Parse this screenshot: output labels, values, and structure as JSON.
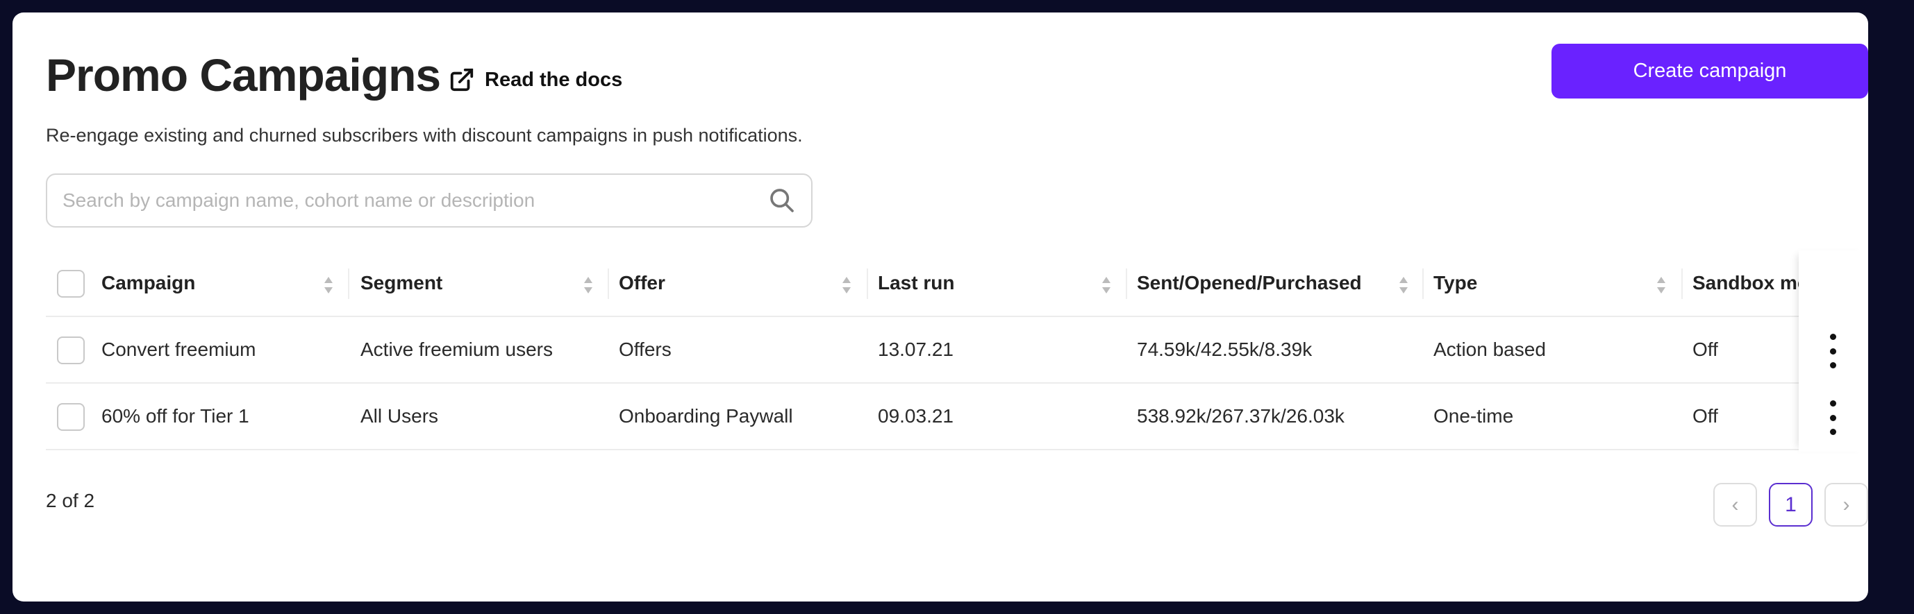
{
  "header": {
    "title": "Promo Campaigns",
    "docs_link": "Read the docs",
    "subtitle": "Re-engage existing and churned subscribers with discount campaigns in push notifications.",
    "create_button": "Create campaign"
  },
  "search": {
    "placeholder": "Search by campaign name, cohort name or description",
    "value": ""
  },
  "table": {
    "columns": [
      "Campaign",
      "Segment",
      "Offer",
      "Last run",
      "Sent/Opened/Purchased",
      "Type",
      "Sandbox mode"
    ],
    "rows": [
      [
        "Convert freemium",
        "Active freemium users",
        "Offers",
        "13.07.21",
        "74.59k/42.55k/8.39k",
        "Action based",
        "Off"
      ],
      [
        "60% off for Tier 1",
        "All Users",
        "Onboarding Paywall",
        "09.03.21",
        "538.92k/267.37k/26.03k",
        "One-time",
        "Off"
      ]
    ]
  },
  "footer": {
    "count": "2 of 2",
    "current_page": "1"
  },
  "colors": {
    "accent": "#6a22ff",
    "background": "#0a0c26"
  }
}
